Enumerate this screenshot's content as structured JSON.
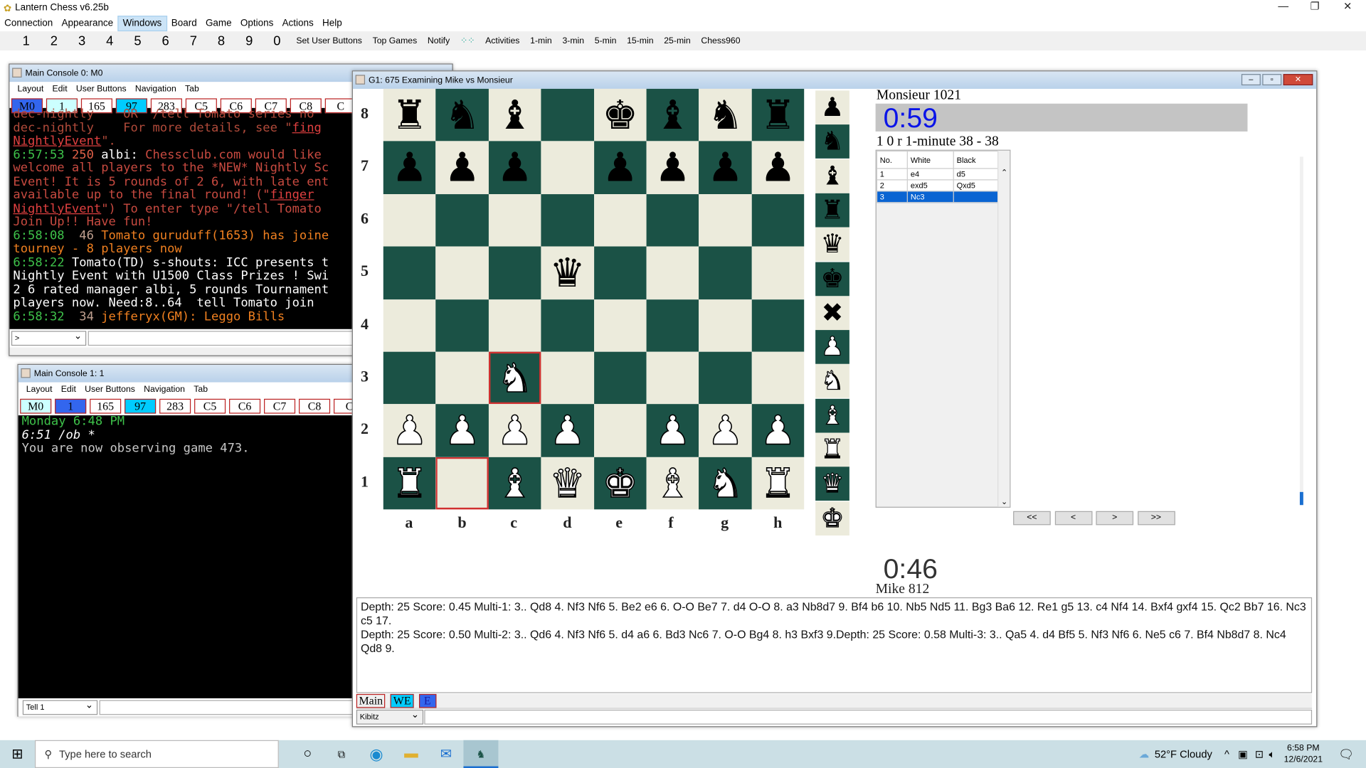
{
  "app": {
    "title": "Lantern Chess v6.25b",
    "menu": [
      "Connection",
      "Appearance",
      "Windows",
      "Board",
      "Game",
      "Options",
      "Actions",
      "Help"
    ],
    "active_menu": "Windows"
  },
  "toolbar": {
    "numbers": [
      "1",
      "2",
      "3",
      "4",
      "5",
      "6",
      "7",
      "8",
      "9",
      "0"
    ],
    "buttons": [
      "Set User Buttons",
      "Top Games",
      "Notify"
    ],
    "buttons2": [
      "Activities",
      "1-min",
      "3-min",
      "5-min",
      "15-min",
      "25-min",
      "Chess960"
    ]
  },
  "console0": {
    "title": "Main Console 0: M0",
    "menu": [
      "Layout",
      "Edit",
      "User Buttons",
      "Navigation",
      "Tab"
    ],
    "tabs": [
      {
        "label": "M0",
        "bg": "#3366ee"
      },
      {
        "label": "1",
        "bg": "#ccffff"
      },
      {
        "label": "165",
        "bg": "#ffffff"
      },
      {
        "label": "97",
        "bg": "#00ccff"
      },
      {
        "label": "283",
        "bg": "#ffffff"
      },
      {
        "label": "C5",
        "bg": "#ffffff"
      },
      {
        "label": "C6",
        "bg": "#ffffff"
      },
      {
        "label": "C7",
        "bg": "#ffffff"
      },
      {
        "label": "C8",
        "bg": "#ffffff"
      },
      {
        "label": "C",
        "bg": "#ffffff"
      }
    ],
    "lines": [
      [
        {
          "t": "dec-nightly    OR  /tell Tomato series no",
          "c": "#b04a3a"
        }
      ],
      [
        {
          "t": "dec-nightly    For more details, see \"",
          "c": "#b04a3a"
        },
        {
          "t": "fing",
          "c": "#e04040",
          "u": true
        }
      ],
      [
        {
          "t": "NightlyEvent",
          "c": "#e04040",
          "u": true
        },
        {
          "t": "\".",
          "c": "#b04a3a"
        }
      ],
      [
        {
          "t": "6:57:53 ",
          "c": "#3ec24a"
        },
        {
          "t": "250 ",
          "c": "#e06048"
        },
        {
          "t": "albi: ",
          "c": "#ffffff"
        },
        {
          "t": "Chessclub.com would like",
          "c": "#c84a40"
        }
      ],
      [
        {
          "t": "welcome all players to the *NEW* Nightly Sc",
          "c": "#c84a40"
        }
      ],
      [
        {
          "t": "Event! It is 5 rounds of 2 6, with late ent",
          "c": "#c84a40"
        }
      ],
      [
        {
          "t": "available up to the final round! (\"",
          "c": "#c84a40"
        },
        {
          "t": "finger",
          "c": "#e04040",
          "u": true
        }
      ],
      [
        {
          "t": "NightlyEvent",
          "c": "#e04040",
          "u": true
        },
        {
          "t": "\") To enter type \"/tell Tomato",
          "c": "#c84a40"
        }
      ],
      [
        {
          "t": "Join Up!! Have fun!",
          "c": "#c84a40"
        }
      ],
      [
        {
          "t": "6:58:08 ",
          "c": "#3ec24a"
        },
        {
          "t": " 46 ",
          "c": "#c0a090"
        },
        {
          "t": "Tomato guruduff(1653) has joine",
          "c": "#f08020"
        }
      ],
      [
        {
          "t": "tourney - 8 players now",
          "c": "#f08020"
        }
      ],
      [
        {
          "t": "6:58:22 ",
          "c": "#3ec24a"
        },
        {
          "t": "Tomato(TD) s-shouts: ICC presents t",
          "c": "#ffffff"
        }
      ],
      [
        {
          "t": "Nightly Event with U1500 Class Prizes ! Swi",
          "c": "#ffffff"
        }
      ],
      [
        {
          "t": "2 6 rated manager albi, 5 rounds Tournament",
          "c": "#ffffff"
        }
      ],
      [
        {
          "t": "players now. Need:8..64  tell Tomato join",
          "c": "#ffffff"
        }
      ],
      [
        {
          "t": "6:58:32 ",
          "c": "#3ec24a"
        },
        {
          "t": " 34 ",
          "c": "#c0a090"
        },
        {
          "t": "jefferyx(GM): Leggo Bills",
          "c": "#f08020"
        }
      ]
    ],
    "input_select": ">"
  },
  "console1": {
    "title": "Main Console 1: 1",
    "menu": [
      "Layout",
      "Edit",
      "User Buttons",
      "Navigation",
      "Tab"
    ],
    "tabs": [
      {
        "label": "M0",
        "bg": "#ccffff"
      },
      {
        "label": "1",
        "bg": "#3366ee"
      },
      {
        "label": "165",
        "bg": "#ffffff"
      },
      {
        "label": "97",
        "bg": "#00ccff"
      },
      {
        "label": "283",
        "bg": "#ffffff"
      },
      {
        "label": "C5",
        "bg": "#ffffff"
      },
      {
        "label": "C6",
        "bg": "#ffffff"
      },
      {
        "label": "C7",
        "bg": "#ffffff"
      },
      {
        "label": "C8",
        "bg": "#ffffff"
      },
      {
        "label": "C",
        "bg": "#ffffff"
      }
    ],
    "lines": [
      [
        {
          "t": "Monday 6:48 PM",
          "c": "#3ec24a"
        }
      ],
      [
        {
          "t": "6:51 /ob *",
          "c": "#ffffff",
          "i": true
        }
      ],
      [
        {
          "t": "You are now observing game 473.",
          "c": "#c8c8c8"
        }
      ]
    ],
    "input_select": "Tell 1"
  },
  "game": {
    "title": "G1: 675 Examining Mike vs Monsieur",
    "colors": {
      "dark": "#1b5246",
      "light": "#ecebdc",
      "highlight": "#d03030"
    },
    "board": [
      "rnb.kbnr",
      "ppp.pppp",
      "........",
      "...q....",
      "........",
      "..N.....",
      "PPPP.PPP",
      "R.BQKBNR"
    ],
    "highlights": [
      "c3",
      "b1"
    ],
    "ranks": [
      "8",
      "7",
      "6",
      "5",
      "4",
      "3",
      "2",
      "1"
    ],
    "files": [
      "a",
      "b",
      "c",
      "d",
      "e",
      "f",
      "g",
      "h"
    ],
    "palette": [
      "p",
      "n",
      "b",
      "r",
      "q",
      "k",
      "x",
      "P",
      "N",
      "B",
      "R",
      "Q",
      "K"
    ],
    "top_player": "Monsieur  1021",
    "top_clock": "0:59",
    "game_info": "1 0 r 1-minute 38 - 38",
    "bottom_clock": "0:46",
    "bottom_player": "Mike  812",
    "moves_header": [
      "No.",
      "White",
      "Black"
    ],
    "moves": [
      [
        "1",
        "e4",
        "d5"
      ],
      [
        "2",
        "exd5",
        "Qxd5"
      ],
      [
        "3",
        "Nc3",
        ""
      ]
    ],
    "selected_move": 2,
    "nav": [
      "<<",
      "<",
      ">",
      ">>"
    ],
    "analysis": [
      "Depth: 25 Score: 0.45 Multi-1: 3.. Qd8 4. Nf3 Nf6 5. Be2 e6 6. O-O Be7 7. d4 O-O 8. a3 Nb8d7 9. Bf4 b6 10. Nb5 Nd5 11. Bg3 Ba6 12. Re1 g5 13. c4 Nf4 14. Bxf4 gxf4 15. Qc2 Bb7 16. Nc3 c5 17.",
      "Depth: 25 Score: 0.50 Multi-2: 3.. Qd6 4. Nf3 Nf6 5. d4 a6 6. Bd3 Nc6 7. O-O Bg4 8. h3 Bxf3 9.Depth: 25 Score: 0.58 Multi-3: 3.. Qa5 4. d4 Bf5 5. Nf3 Nf6 6. Ne5 c6 7. Bf4 Nb8d7 8. Nc4 Qd8 9."
    ],
    "bottom_tabs": [
      {
        "label": "Main",
        "bg": "#f0f0f0",
        "c": "#000"
      },
      {
        "label": "WE",
        "bg": "#00ccff",
        "c": "#000"
      },
      {
        "label": "E",
        "bg": "#3366ee",
        "c": "#1a1aa0"
      }
    ],
    "kibitz": "Kibitz"
  },
  "taskbar": {
    "search_placeholder": "Type here to search",
    "weather": "52°F  Cloudy",
    "time": "6:58 PM",
    "date": "12/6/2021"
  }
}
